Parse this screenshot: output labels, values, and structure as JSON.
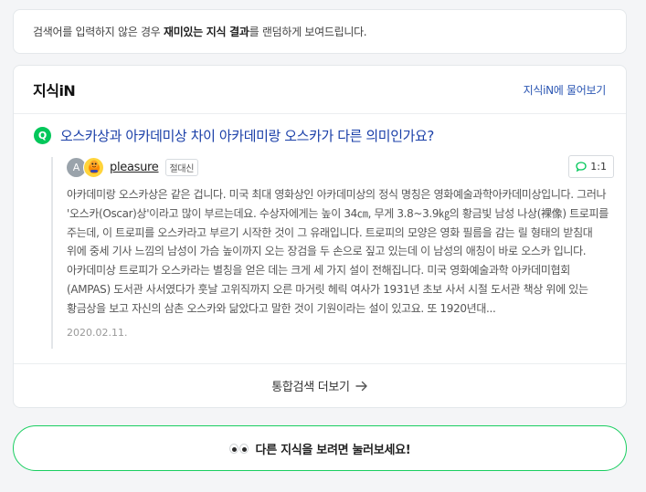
{
  "notice": {
    "prefix": "검색어를 입력하지 않은 경우 ",
    "highlight": "재미있는 지식 결과",
    "suffix": "를 랜덤하게 보여드립니다."
  },
  "card": {
    "title": "지식iN",
    "ask_link": "지식iN에 물어보기",
    "question_badge": "Q",
    "question_title": "오스카상과 아카데미상 차이 아카데미랑 오스카가 다른 의미인가요?",
    "answer": {
      "avatar_initial": "A",
      "username": "pleasure",
      "grade": "절대신",
      "ratio": "1:1",
      "body": "아카데미랑 오스카상은 같은 겁니다. 미국 최대 영화상인 아카데미상의 정식 명칭은 영화예술과학아카데미상입니다. 그러나 '오스카(Oscar)상'이라고 많이 부르는데요. 수상자에게는 높이 34㎝, 무게 3.8~3.9㎏의 황금빛 남성 나상(裸像) 트로피를 주는데, 이 트로피를 오스카라고 부르기 시작한 것이 그 유래입니다. 트로피의 모양은 영화 필름을 감는 릴 형태의 받침대 위에 중세 기사 느낌의 남성이 가슴 높이까지 오는 장검을 두 손으로 짚고 있는데 이 남성의 애칭이 바로 오스카 입니다. 아카데미상 트로피가 오스카라는 별칭을 얻은 데는 크게 세 가지 설이 전해집니다. 미국 영화예술과학 아카데미협회(AMPAS) 도서관 사서였다가 훗날 고위직까지 오른 마거릿 헤릭 여사가 1931년 초보 사서 시절 도서관 책상 위에 있는 황금상을 보고 자신의 삼촌 오스카와 닮았다고 말한 것이 기원이라는 설이 있고요. 또 1920년대...",
      "date": "2020.02.11."
    },
    "more_label": "통합검색 더보기"
  },
  "big_button_label": "다른 지식을 보려면 눌러보세요!",
  "colors": {
    "accent_green": "#03c75a",
    "link_blue": "#2b56b3",
    "question_blue": "#1a3fa8"
  }
}
